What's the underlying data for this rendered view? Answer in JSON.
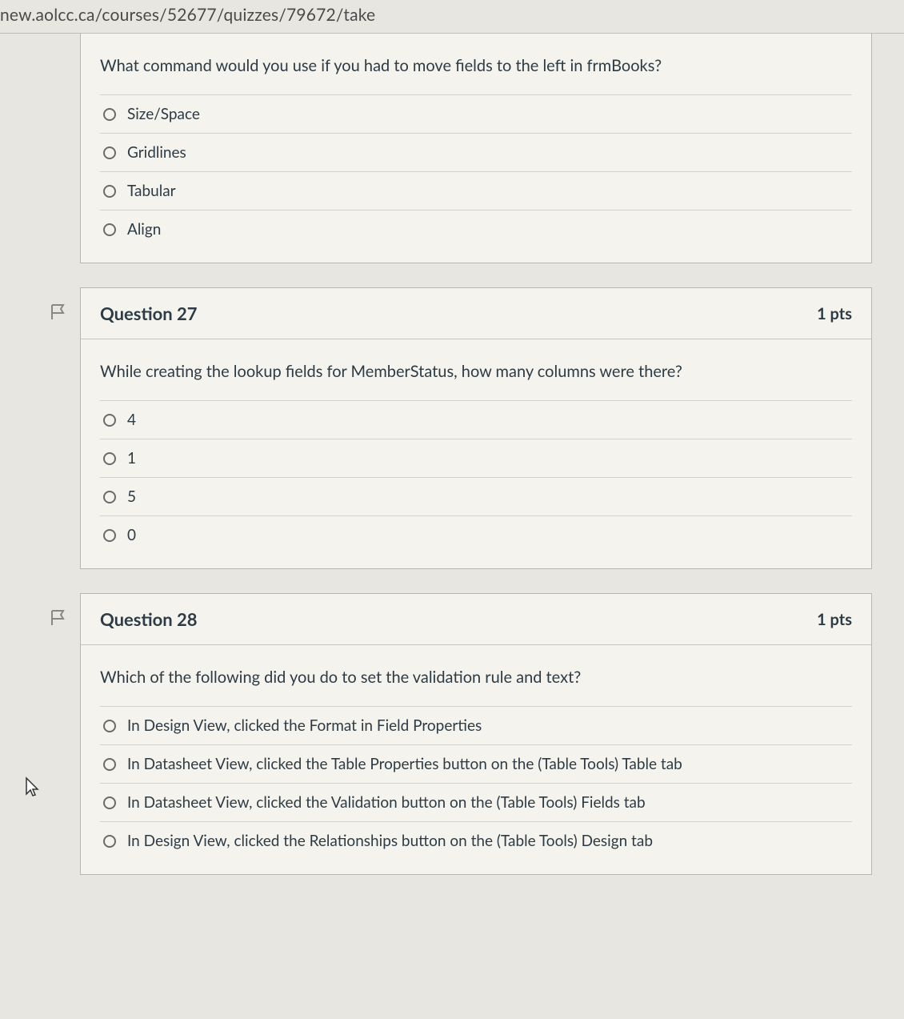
{
  "url": "new.aolcc.ca/courses/52677/quizzes/79672/take",
  "q26": {
    "prompt": "What command would you use if you had to move fields to the left in frmBooks?",
    "options": [
      "Size/Space",
      "Gridlines",
      "Tabular",
      "Align"
    ]
  },
  "q27": {
    "title": "Question 27",
    "points": "1 pts",
    "prompt": "While creating the lookup fields for MemberStatus, how many columns were there?",
    "options": [
      "4",
      "1",
      "5",
      "0"
    ]
  },
  "q28": {
    "title": "Question 28",
    "points": "1 pts",
    "prompt": "Which of the following did you do to set the validation rule and text?",
    "options": [
      "In Design View, clicked the Format in Field Properties",
      "In Datasheet View, clicked the Table Properties button on the (Table Tools) Table tab",
      "In Datasheet View, clicked the Validation button on the (Table Tools) Fields tab",
      "In Design View, clicked the Relationships button on the (Table Tools) Design tab"
    ]
  }
}
